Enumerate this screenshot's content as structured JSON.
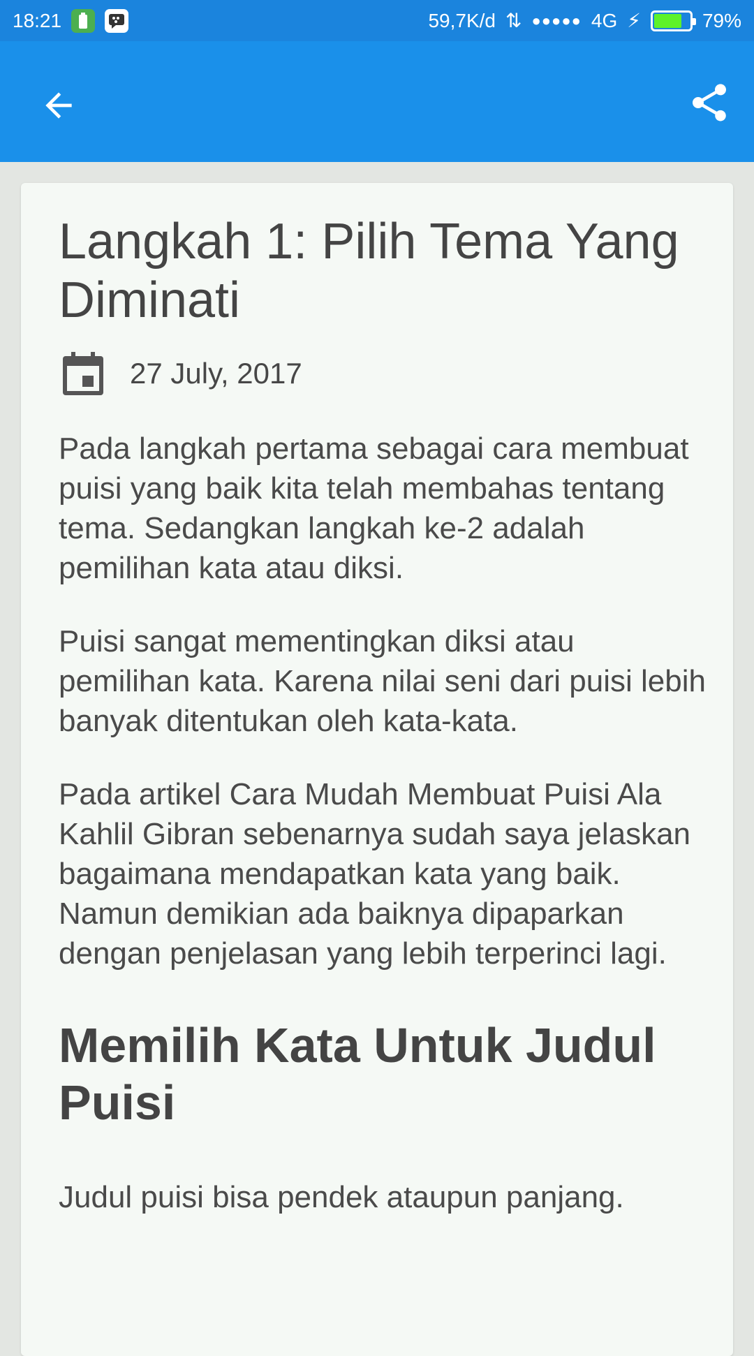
{
  "status_bar": {
    "time": "18:21",
    "network_speed": "59,7K/d",
    "data_arrows": "⇅",
    "signal_dots": "●●●●●",
    "network_type": "4G",
    "charging_symbol": "⚡",
    "battery_percent": "79%",
    "battery_level": 0.79,
    "colors": {
      "bar": "#1b84dd",
      "battery_fill": "#5ef22a"
    }
  },
  "app_bar": {
    "color": "#1a90ea",
    "back_icon": "arrow-back-icon",
    "share_icon": "share-icon"
  },
  "article": {
    "title": "Langkah 1: Pilih Tema Yang Diminati",
    "date_icon": "calendar-icon",
    "date": "27 July, 2017",
    "paragraphs": [
      "Pada langkah pertama sebagai cara membuat puisi yang baik kita telah membahas tentang tema. Sedangkan langkah ke-2 adalah pemilihan kata atau diksi.",
      "Puisi sangat mementingkan diksi atau pemilihan kata. Karena nilai seni dari puisi lebih banyak ditentukan oleh kata-kata.",
      "Pada artikel Cara Mudah Membuat Puisi Ala Kahlil Gibran sebenarnya sudah saya jelaskan bagaimana mendapatkan kata yang baik. Namun demikian ada baiknya dipaparkan dengan penjelasan yang lebih terperinci lagi."
    ],
    "section_heading": "Memilih Kata Untuk Judul Puisi",
    "section_paragraph": "Judul puisi bisa pendek ataupun panjang."
  }
}
